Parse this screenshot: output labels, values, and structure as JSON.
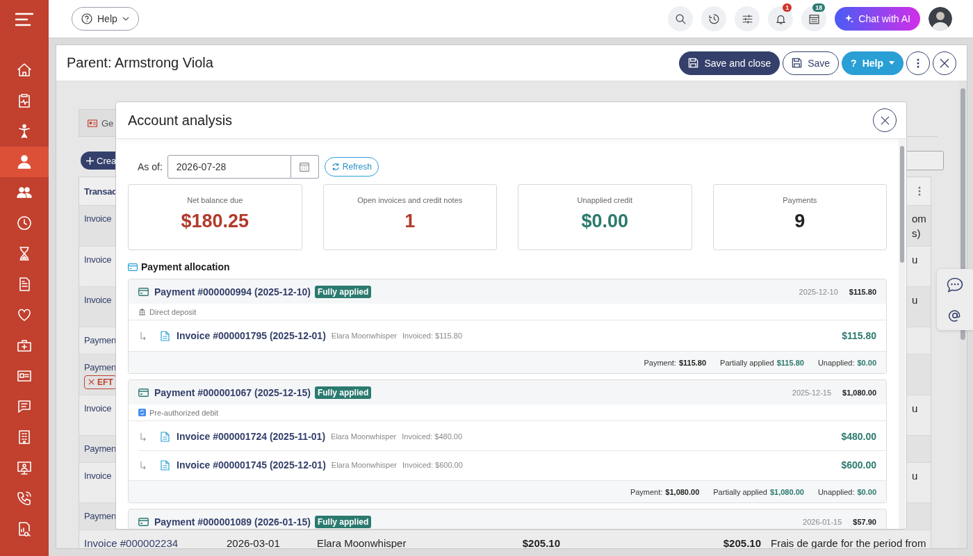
{
  "sidebar": {
    "items": [
      {
        "selected": false
      },
      {
        "selected": false
      },
      {
        "selected": false
      },
      {
        "selected": true
      },
      {
        "selected": false
      },
      {
        "selected": false
      },
      {
        "selected": false
      },
      {
        "selected": false
      },
      {
        "selected": false
      },
      {
        "selected": false
      },
      {
        "selected": false
      },
      {
        "selected": false
      },
      {
        "selected": false
      },
      {
        "selected": false
      },
      {
        "selected": false
      },
      {
        "selected": false
      }
    ]
  },
  "topbar": {
    "help": "Help",
    "notification_badge": "1",
    "calendar_badge": "18",
    "chat_button": "Chat with AI"
  },
  "page": {
    "title": "Parent: Armstrong Viola",
    "buttons": [
      {
        "label": "Save and close",
        "kind": "primary"
      },
      {
        "label": "Save",
        "kind": "outline"
      },
      {
        "label": "Help",
        "kind": "info",
        "icon_text": "?"
      }
    ]
  },
  "background": {
    "tab": "Ge",
    "create_button": "Crea",
    "table": {
      "header": "Transac",
      "rows": [
        {
          "kind": "invoice",
          "transaction": "Invoice",
          "description": [
            "om",
            "s)"
          ]
        },
        {
          "kind": "invoice",
          "transaction": "Invoice",
          "description": [
            "u"
          ]
        },
        {
          "kind": "invoice",
          "transaction": "Invoice",
          "description": [
            "u"
          ]
        },
        {
          "kind": "payment",
          "transaction": "Paymen"
        },
        {
          "kind": "payment",
          "transaction": "Paymen",
          "badge": "EFT"
        },
        {
          "kind": "invoice",
          "transaction": "Invoice",
          "description": [
            "u"
          ]
        },
        {
          "kind": "payment",
          "transaction": "Paymen"
        },
        {
          "kind": "invoice",
          "transaction": "Invoice",
          "description": [
            "u"
          ]
        },
        {
          "kind": "payment",
          "transaction": "Paymen"
        },
        {
          "kind": "invoice",
          "transaction": "Invoice #000002234",
          "date": "2026-03-01",
          "name": "Elara Moonwhisper",
          "amount": "$205.10",
          "balance": "$205.10",
          "description": [
            "Frais de garde for the period from"
          ]
        }
      ]
    }
  },
  "modal": {
    "title": "Account analysis",
    "as_of_label": "As of:",
    "date": "2026-07-28",
    "refresh": "Refresh",
    "stats": [
      {
        "label": "Net balance due",
        "value": "$180.25",
        "color": "#b23a2b"
      },
      {
        "label": "Open invoices and credit notes",
        "value": "1",
        "color": "#b23a2b"
      },
      {
        "label": "Unapplied credit",
        "value": "$0.00",
        "color": "#2b7a6f"
      },
      {
        "label": "Payments",
        "value": "9",
        "color": "#222222"
      }
    ],
    "section_title": "Payment allocation",
    "payments": [
      {
        "title": "Payment #000000994 (2025-12-10)",
        "status": "Fully applied",
        "date": "2025-12-10",
        "amount": "$115.80",
        "method": {
          "text": "Direct deposit",
          "kind": "bank"
        },
        "allocations": [
          {
            "title": "Invoice #000001795 (2025-12-01)",
            "name": "Elara Moonwhisper",
            "invoiced": "Invoiced: $115.80",
            "amount": "$115.80"
          }
        ],
        "totals": [
          {
            "label": "Payment:",
            "value": "$115.80",
            "kind": "plain"
          },
          {
            "label": "Partially applied",
            "value": "$115.80",
            "kind": "applied"
          },
          {
            "label": "Unapplied:",
            "value": "$0.00",
            "kind": "applied"
          }
        ]
      },
      {
        "title": "Payment #000001067 (2025-12-15)",
        "status": "Fully applied",
        "date": "2025-12-15",
        "amount": "$1,080.00",
        "method": {
          "text": "Pre-authorized debit",
          "kind": "debit"
        },
        "allocations": [
          {
            "title": "Invoice #000001724 (2025-11-01)",
            "name": "Elara Moonwhisper",
            "invoiced": "Invoiced: $480.00",
            "amount": "$480.00"
          },
          {
            "title": "Invoice #000001745 (2025-12-01)",
            "name": "Elara Moonwhisper",
            "invoiced": "Invoiced: $600.00",
            "amount": "$600.00"
          }
        ],
        "totals": [
          {
            "label": "Payment:",
            "value": "$1,080.00",
            "kind": "plain"
          },
          {
            "label": "Partially applied",
            "value": "$1,080.00",
            "kind": "applied"
          },
          {
            "label": "Unapplied:",
            "value": "$0.00",
            "kind": "applied"
          }
        ]
      },
      {
        "title": "Payment #000001089 (2026-01-15)",
        "status": "Fully applied",
        "date": "2026-01-15",
        "amount": "$57.90"
      }
    ]
  }
}
